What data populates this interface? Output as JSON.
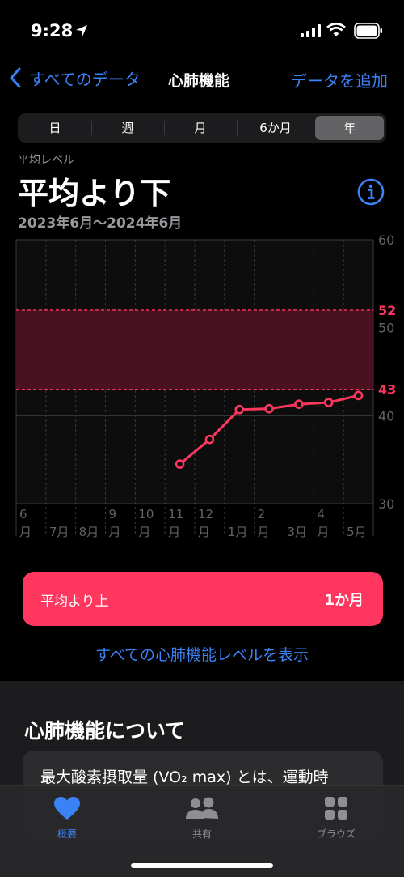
{
  "status": {
    "time": "9:28"
  },
  "nav": {
    "back_label": "すべてのデータ",
    "title": "心肺機能",
    "action_label": "データを追加"
  },
  "segments": [
    {
      "label": "日",
      "active": false
    },
    {
      "label": "週",
      "active": false
    },
    {
      "label": "月",
      "active": false
    },
    {
      "label": "6か月",
      "active": false
    },
    {
      "label": "年",
      "active": true
    }
  ],
  "summary": {
    "label": "平均レベル",
    "value": "平均より下",
    "date_range": "2023年6月〜2024年6月"
  },
  "colors": {
    "accent": "#3b82f6",
    "pink": "#ff375f",
    "band": "#4a1220"
  },
  "chart_data": {
    "type": "line",
    "ylim": [
      30,
      60
    ],
    "y_ticks": [
      "60",
      "50",
      "40",
      "30"
    ],
    "band": {
      "low": 43,
      "high": 52,
      "low_label": "43",
      "high_label": "52"
    },
    "months": [
      {
        "top": "6",
        "bottom": "月"
      },
      {
        "top": "",
        "bottom": "7月"
      },
      {
        "top": "",
        "bottom": "8月"
      },
      {
        "top": "9",
        "bottom": "月"
      },
      {
        "top": "10",
        "bottom": "月"
      },
      {
        "top": "11",
        "bottom": "月"
      },
      {
        "top": "12",
        "bottom": "月"
      },
      {
        "top": "",
        "bottom": "1月"
      },
      {
        "top": "2",
        "bottom": "月"
      },
      {
        "top": "",
        "bottom": "3月"
      },
      {
        "top": "4",
        "bottom": "月"
      },
      {
        "top": "",
        "bottom": "5月"
      }
    ],
    "series": [
      {
        "x": [
          "2023-11",
          "2023-12",
          "2024-01",
          "2024-02",
          "2024-03",
          "2024-04",
          "2024-05"
        ],
        "values": [
          34.5,
          37.3,
          40.7,
          40.8,
          41.3,
          41.5,
          42.3
        ]
      }
    ]
  },
  "above_average": {
    "label": "平均より上",
    "value": "1か月"
  },
  "show_all_link": "すべての心肺機能レベルを表示",
  "about": {
    "title": "心肺機能について",
    "text": "最大酸素摂取量 (VO₂ max) とは、運動時"
  },
  "tabs": [
    {
      "label": "概要",
      "icon": "heart-icon",
      "active": true
    },
    {
      "label": "共有",
      "icon": "people-icon",
      "active": false
    },
    {
      "label": "ブラウズ",
      "icon": "grid-icon",
      "active": false
    }
  ]
}
